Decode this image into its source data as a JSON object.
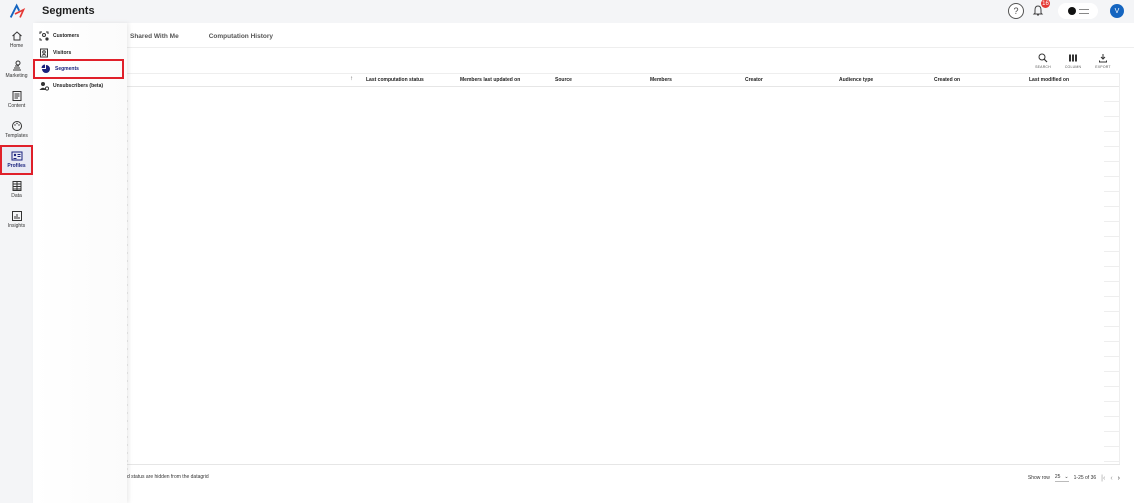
{
  "app": {
    "title": "Segments",
    "notification_count": "16",
    "avatar_initial": "V"
  },
  "rail": [
    {
      "id": "home",
      "label": "Home",
      "icon": "home-icon"
    },
    {
      "id": "marketing",
      "label": "Marketing",
      "icon": "marketing-icon"
    },
    {
      "id": "content",
      "label": "Content",
      "icon": "content-icon"
    },
    {
      "id": "templates",
      "label": "Templates",
      "icon": "palette-icon"
    },
    {
      "id": "profiles",
      "label": "Profiles",
      "icon": "profile-card-icon",
      "active": true
    },
    {
      "id": "data",
      "label": "Data",
      "icon": "data-icon"
    },
    {
      "id": "insights",
      "label": "Insights",
      "icon": "insights-icon"
    }
  ],
  "flyout": [
    {
      "label": "Customers",
      "icon": "customers-icon"
    },
    {
      "label": "Visitors",
      "icon": "visitors-icon"
    },
    {
      "label": "Segments",
      "icon": "pie-chart-icon",
      "active": true
    },
    {
      "label": "Unsubscribers (beta)",
      "icon": "unsubscribers-icon"
    }
  ],
  "tabs": [
    "Shared With Me",
    "Computation History"
  ],
  "toolbar": {
    "search": "SEARCH",
    "column": "COLUMN",
    "export": "EXPORT"
  },
  "grid": {
    "first_col_fragment": "e",
    "columns": [
      "Last computation status",
      "Members last updated on",
      "Source",
      "Members",
      "Creator",
      "Audience type",
      "Created on",
      "Last modified on"
    ]
  },
  "footer": {
    "note": "d status are hidden from the datagrid",
    "show_row_label": "Show row",
    "rows_value": "25",
    "range": "1-25 of 36"
  },
  "colors": {
    "accent": "#1565c0",
    "highlight": "#e0202a"
  }
}
